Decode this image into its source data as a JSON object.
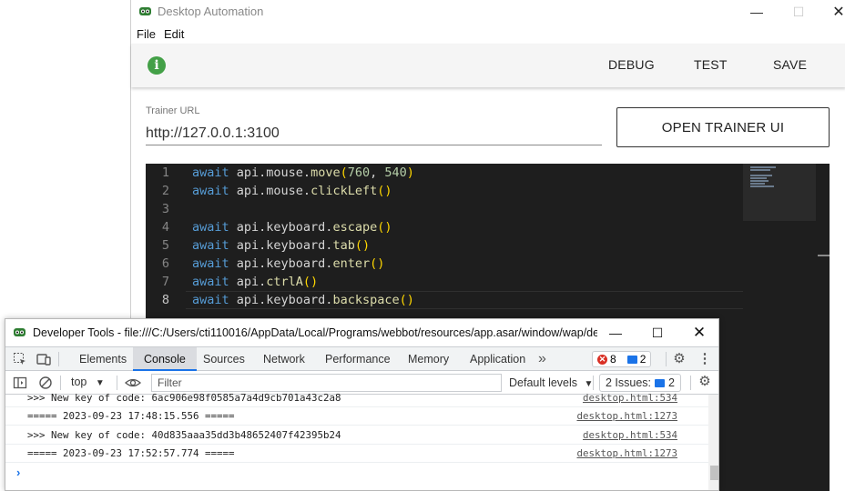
{
  "app": {
    "title": "Desktop Automation",
    "menu": [
      "File",
      "Edit"
    ],
    "toolbar": {
      "debug": "DEBUG",
      "test": "TEST",
      "save": "SAVE"
    },
    "status_icon_glyph": "i",
    "trainer": {
      "label": "Trainer URL",
      "value": "http://127.0.0.1:3100",
      "button": "OPEN TRAINER UI"
    },
    "colors": {
      "status_green": "#43a047",
      "editor_bg": "#1e1e1e"
    }
  },
  "code": {
    "current_line": 8,
    "lines": [
      {
        "no": "1",
        "tokens": [
          [
            "kw",
            "await"
          ],
          [
            "id",
            " api."
          ],
          [
            "id",
            "mouse."
          ],
          [
            "fn",
            "move"
          ],
          [
            "par",
            "("
          ],
          [
            "num",
            "760"
          ],
          [
            "pun",
            ", "
          ],
          [
            "num",
            "540"
          ],
          [
            "par",
            ")"
          ]
        ]
      },
      {
        "no": "2",
        "tokens": [
          [
            "kw",
            "await"
          ],
          [
            "id",
            " api."
          ],
          [
            "id",
            "mouse."
          ],
          [
            "fn",
            "clickLeft"
          ],
          [
            "par",
            "()"
          ]
        ]
      },
      {
        "no": "3",
        "tokens": []
      },
      {
        "no": "4",
        "tokens": [
          [
            "kw",
            "await"
          ],
          [
            "id",
            " api."
          ],
          [
            "id",
            "keyboard."
          ],
          [
            "fn",
            "escape"
          ],
          [
            "par",
            "()"
          ]
        ]
      },
      {
        "no": "5",
        "tokens": [
          [
            "kw",
            "await"
          ],
          [
            "id",
            " api."
          ],
          [
            "id",
            "keyboard."
          ],
          [
            "fn",
            "tab"
          ],
          [
            "par",
            "()"
          ]
        ]
      },
      {
        "no": "6",
        "tokens": [
          [
            "kw",
            "await"
          ],
          [
            "id",
            " api."
          ],
          [
            "id",
            "keyboard."
          ],
          [
            "fn",
            "enter"
          ],
          [
            "par",
            "()"
          ]
        ]
      },
      {
        "no": "7",
        "tokens": [
          [
            "kw",
            "await"
          ],
          [
            "id",
            " api."
          ],
          [
            "fn",
            "ctrlA"
          ],
          [
            "par",
            "()"
          ]
        ]
      },
      {
        "no": "8",
        "tokens": [
          [
            "kw",
            "await"
          ],
          [
            "id",
            " api."
          ],
          [
            "id",
            "keyboard."
          ],
          [
            "fn",
            "backspace"
          ],
          [
            "par",
            "()"
          ]
        ]
      }
    ]
  },
  "devtools": {
    "title": "Developer Tools - file:///C:/Users/cti110016/AppData/Local/Programs/webbot/resources/app.asar/window/wap/de...",
    "tabs": [
      "Elements",
      "Console",
      "Sources",
      "Network",
      "Performance",
      "Memory",
      "Application"
    ],
    "active_tab": "Console",
    "more_tabs": "»",
    "error_count": "8",
    "message_count": "2",
    "context": "top",
    "filter_placeholder": "Filter",
    "levels": "Default levels",
    "issues_label": "2 Issues:",
    "issues_count": "2",
    "logs": [
      {
        "text": ">>> New key of code: 6ac906e98f0585a7a4d9cb701a43c2a8",
        "source": "desktop.html:534"
      },
      {
        "text": "===== 2023-09-23 17:48:15.556 =====",
        "source": "desktop.html:1273"
      },
      {
        "text": ">>> New key of code: 40d835aaa35dd3b48652407f42395b24",
        "source": "desktop.html:534"
      },
      {
        "text": "===== 2023-09-23 17:52:57.774 =====",
        "source": "desktop.html:1273"
      }
    ],
    "prompt": "›"
  }
}
